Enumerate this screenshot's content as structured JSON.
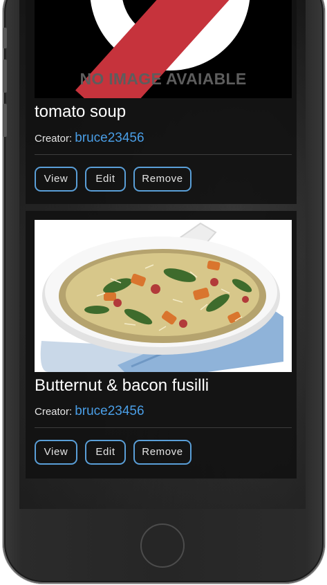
{
  "recipes": [
    {
      "title": "tomato soup",
      "creator_label": "Creator:",
      "creator_name": "bruce23456",
      "image_text": "NO IMAGE AVAIABLE",
      "buttons": {
        "view": "View",
        "edit": "Edit",
        "remove": "Remove"
      }
    },
    {
      "title": "Butternut & bacon fusilli",
      "creator_label": "Creator:",
      "creator_name": "bruce23456",
      "buttons": {
        "view": "View",
        "edit": "Edit",
        "remove": "Remove"
      }
    }
  ],
  "colors": {
    "link": "#4a9ee6",
    "button_border": "#5a9fd8",
    "no_image_slash": "#c6333c"
  }
}
